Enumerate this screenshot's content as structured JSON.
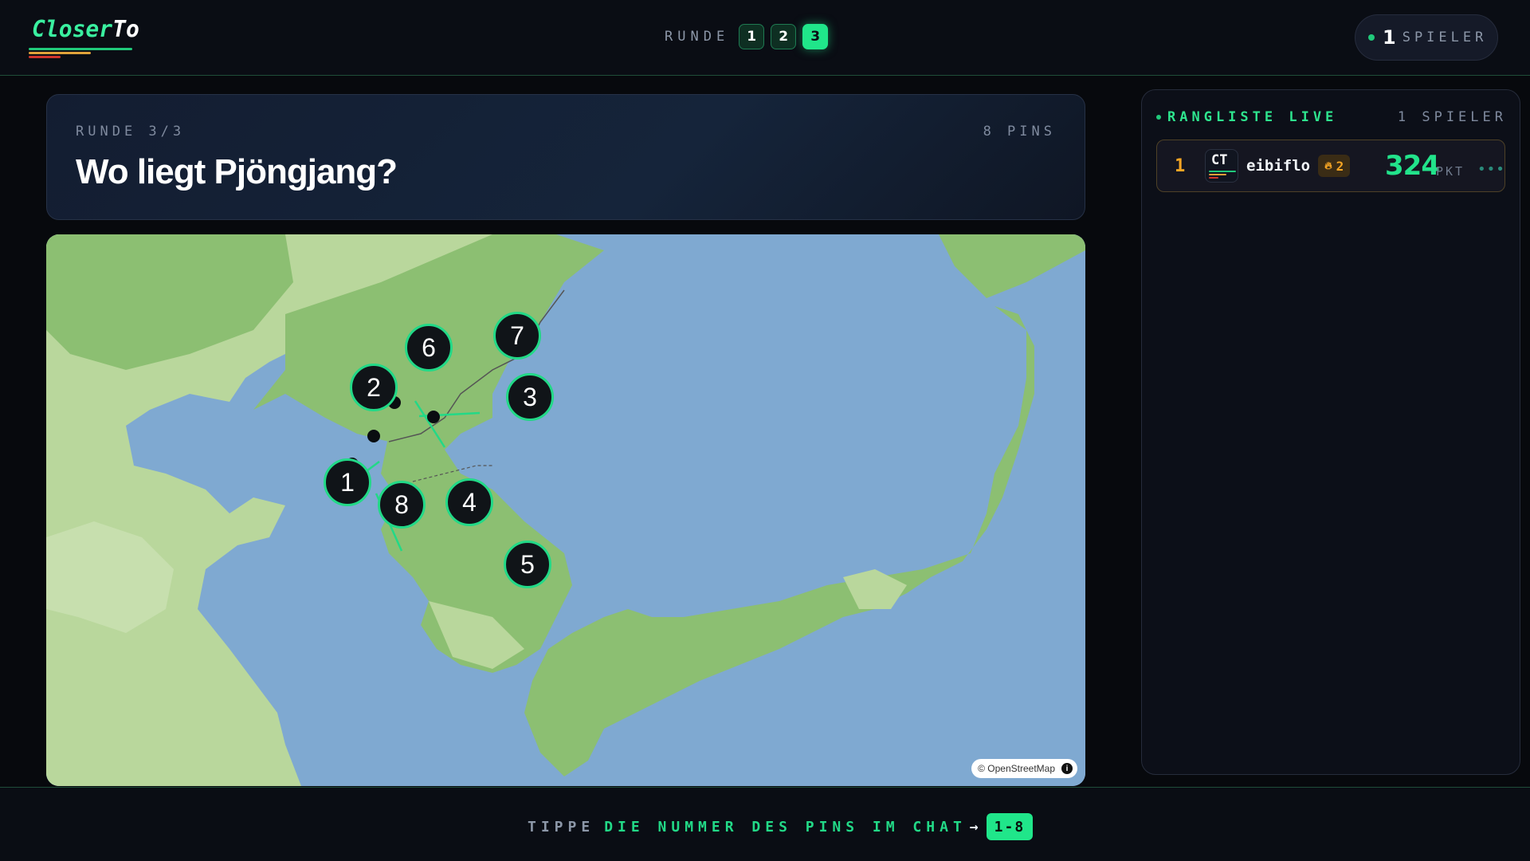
{
  "app": {
    "logo": "CloserTo",
    "logo_part1": "Closer",
    "logo_part2": "To"
  },
  "header": {
    "rounds_label": "RUNDE",
    "rounds": [
      {
        "label": "1",
        "active": false
      },
      {
        "label": "2",
        "active": false
      },
      {
        "label": "3",
        "active": true
      }
    ],
    "players_count": "1",
    "players_label": "SPIELER"
  },
  "question": {
    "round_text": "RUNDE 3/3",
    "pins_text": "8 PINS",
    "title": "Wo liegt Pjöngjang?"
  },
  "map": {
    "attribution": "© OpenStreetMap",
    "info_icon": "info-icon",
    "pins": [
      {
        "label": "1"
      },
      {
        "label": "2"
      },
      {
        "label": "3"
      },
      {
        "label": "4"
      },
      {
        "label": "5"
      },
      {
        "label": "6"
      },
      {
        "label": "7"
      },
      {
        "label": "8"
      }
    ]
  },
  "leaderboard": {
    "title": "RANGLISTE LIVE",
    "count_text": "1 SPIELER",
    "rows": [
      {
        "rank": "1",
        "avatar": "CT",
        "name": "eibiflo",
        "streak": "2",
        "streak_icon": "flame-icon",
        "score": "324",
        "unit": "PKT",
        "more": "•••"
      }
    ]
  },
  "footer": {
    "hint_prefix": "TIPPE",
    "hint_main": "DIE NUMMER DES PINS IM CHAT",
    "arrow": "→",
    "range": "1-8"
  },
  "colors": {
    "accent": "#20e68a",
    "background": "#07090d",
    "gold": "#f5a524",
    "sea": "#7fa9d1",
    "land": "#8cbf72"
  }
}
